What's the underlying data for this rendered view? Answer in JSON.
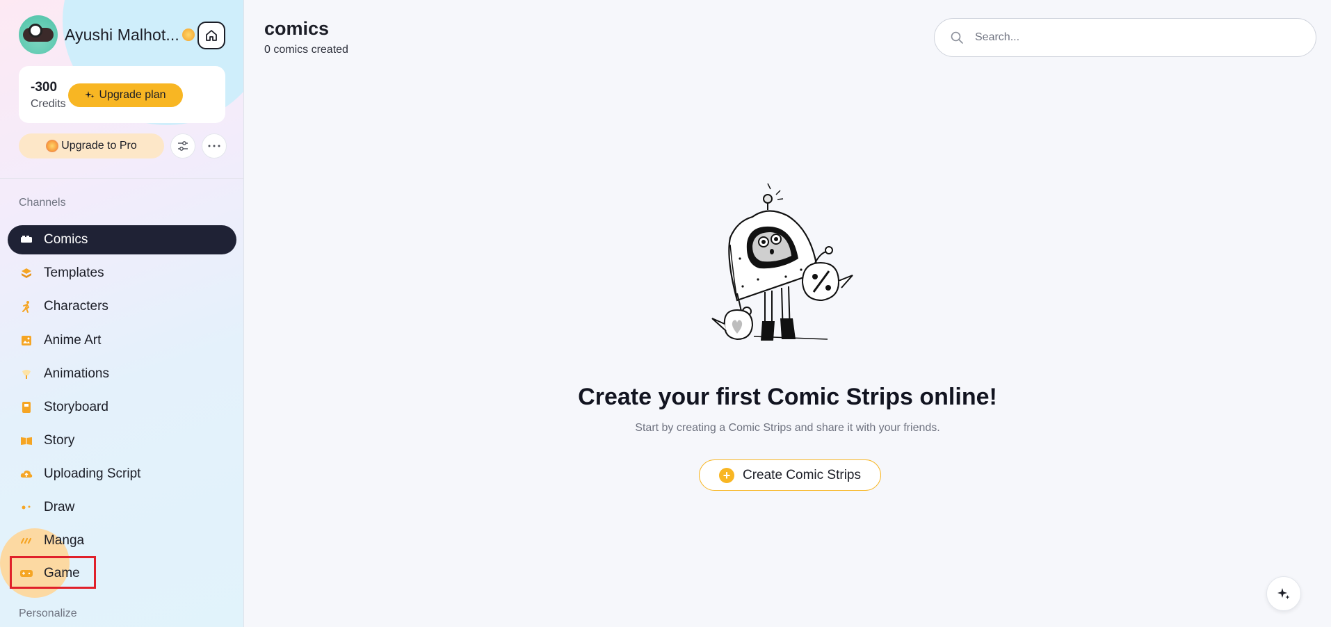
{
  "user": {
    "name": "Ayushi Malhot..."
  },
  "credits": {
    "value": "-300",
    "label": "Credits",
    "upgrade_plan_label": "Upgrade plan"
  },
  "upgrade_pro_label": "Upgrade to Pro",
  "channels_label": "Channels",
  "personalize_label": "Personalize",
  "nav": {
    "items": [
      {
        "label": "Comics",
        "icon": "comics-icon",
        "active": true
      },
      {
        "label": "Templates",
        "icon": "templates-icon"
      },
      {
        "label": "Characters",
        "icon": "characters-icon"
      },
      {
        "label": "Anime Art",
        "icon": "anime-art-icon"
      },
      {
        "label": "Animations",
        "icon": "animations-icon"
      },
      {
        "label": "Storyboard",
        "icon": "storyboard-icon"
      },
      {
        "label": "Story",
        "icon": "story-icon"
      },
      {
        "label": "Uploading Script",
        "icon": "upload-script-icon"
      },
      {
        "label": "Draw",
        "icon": "draw-icon"
      },
      {
        "label": "Manga",
        "icon": "manga-icon"
      },
      {
        "label": "Game",
        "icon": "game-icon"
      }
    ]
  },
  "main": {
    "title": "comics",
    "subtitle": "0 comics created",
    "search_placeholder": "Search...",
    "empty_title": "Create your first Comic Strips online!",
    "empty_sub": "Start by creating a Comic Strips and share it with your friends.",
    "create_label": "Create Comic Strips"
  },
  "colors": {
    "accent": "#f8b623",
    "active_nav": "#1f2235",
    "highlight": "#e0202a"
  }
}
